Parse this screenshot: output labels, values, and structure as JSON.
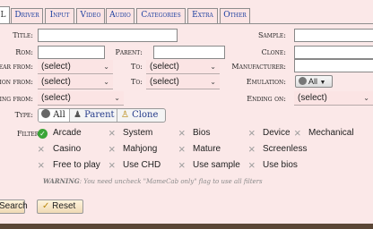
{
  "tabs": [
    "L",
    "Driver",
    "Input",
    "Video",
    "Audio",
    "Categories",
    "Extra",
    "Other"
  ],
  "form": {
    "title_label": "Title:",
    "sample_label": "Sample:",
    "rom_label": "Rom:",
    "parent_label": "Parent:",
    "clone_label": "Clone:",
    "year_from_label": "Year from:",
    "year_from_value": "(select)",
    "year_to_label": "To:",
    "year_to_value": "(select)",
    "manufacturer_label": "Manufacturer:",
    "version_from_label": "sion from:",
    "version_from_value": "(select)",
    "version_to_label": "To:",
    "version_to_value": "(select)",
    "emulation_label": "Emulation:",
    "emulation_value": "All",
    "rating_from_label": "ting from:",
    "rating_from_value": "(select)",
    "ending_on_label": "Ending on:",
    "ending_on_value": "(select)",
    "type_label": "Type:",
    "type_all": "All",
    "type_parent": "Parent",
    "type_clone": "Clone",
    "filter_label": "Filter:"
  },
  "filters": [
    {
      "label": "Arcade",
      "checked": true
    },
    {
      "label": "System",
      "checked": false
    },
    {
      "label": "Bios",
      "checked": false
    },
    {
      "label": "Device",
      "checked": false
    },
    {
      "label": "Mechanical",
      "checked": false
    },
    {
      "label": "Casino",
      "checked": false
    },
    {
      "label": "Mahjong",
      "checked": false
    },
    {
      "label": "Mature",
      "checked": false
    },
    {
      "label": "Screenless",
      "checked": false
    },
    {
      "label": "Free to play",
      "checked": false
    },
    {
      "label": "Use CHD",
      "checked": false
    },
    {
      "label": "Use sample",
      "checked": false
    },
    {
      "label": "Use bios",
      "checked": false
    }
  ],
  "warning": {
    "strong": "WARNING",
    "text": ": You need uncheck \"MameCab only\" flag to use all filters"
  },
  "buttons": {
    "search": "Search",
    "reset": "Reset"
  }
}
